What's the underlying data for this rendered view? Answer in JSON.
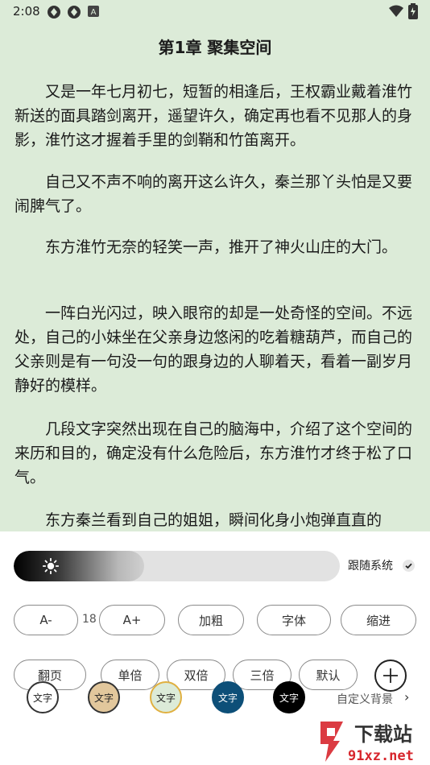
{
  "status_bar": {
    "time": "2:08"
  },
  "reader": {
    "chapter_title": "第1章 聚集空间",
    "paragraphs": [
      "又是一年七月初七，短暂的相逢后，王权霸业戴着淮竹新送的面具踏剑离开，遥望许久，确定再也看不见那人的身影，淮竹这才握着手里的剑鞘和竹笛离开。",
      "自己又不声不响的离开这么许久，秦兰那丫头怕是又要闹脾气了。",
      "东方淮竹无奈的轻笑一声，推开了神火山庄的大门。",
      "一阵白光闪过，映入眼帘的却是一处奇怪的空间。不远处，自己的小妹坐在父亲身边悠闲的吃着糖葫芦，而自己的父亲则是有一句没一句的跟身边的人聊着天，看着一副岁月静好的模样。",
      "几段文字突然出现在自己的脑海中，介绍了这个空间的来历和目的，确定没有什么危险后，东方淮竹才终于松了口气。",
      "东方秦兰看到自己的姐姐，瞬间化身小炮弹直直的"
    ]
  },
  "settings": {
    "brightness": 0.4,
    "follow_system_label": "跟随系统",
    "font_size_value": "18",
    "font_row": {
      "decrease": "A-",
      "increase": "A+",
      "bold": "加粗",
      "font": "字体",
      "indent": "缩进"
    },
    "spacing_row": {
      "page_turn": "翻页",
      "single": "单倍",
      "double": "双倍",
      "triple": "三倍",
      "default": "默认"
    },
    "themes": [
      {
        "label": "文字",
        "bg": "#ffffff",
        "border": "#333333",
        "text": "#222222"
      },
      {
        "label": "文字",
        "bg": "#e2c79c",
        "border": "#333333",
        "text": "#222222"
      },
      {
        "label": "文字",
        "bg": "#dcebd8",
        "border": "#e0b040",
        "text": "#222222"
      },
      {
        "label": "文字",
        "bg": "#0d4f78",
        "border": "#0d4f78",
        "text": "#ffffff"
      },
      {
        "label": "文字",
        "bg": "#000000",
        "border": "#000000",
        "text": "#ffffff"
      }
    ],
    "more_label": "自定义背景",
    "watermark": {
      "text": "下载站",
      "url": "91xz.net"
    }
  }
}
